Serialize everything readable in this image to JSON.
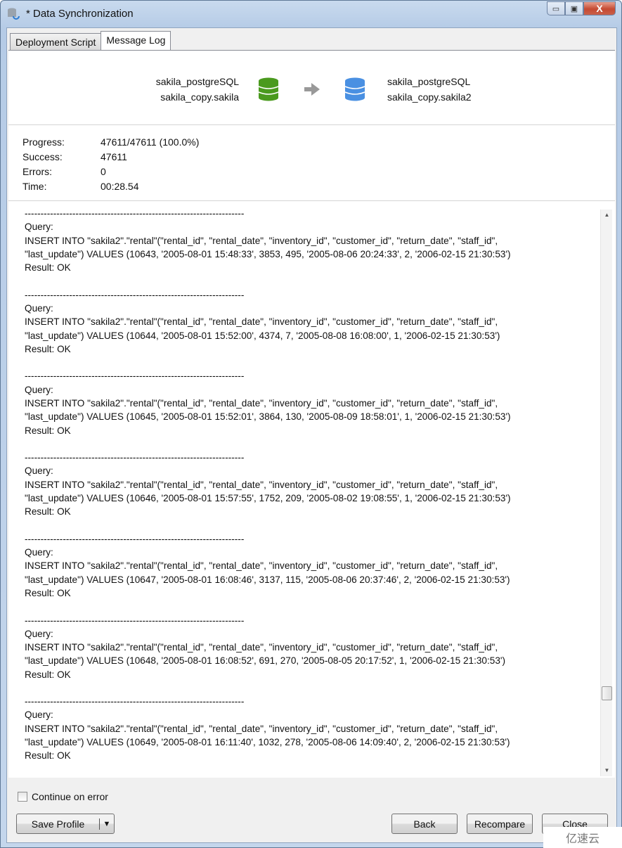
{
  "window": {
    "title": "* Data Synchronization",
    "buttons": {
      "minimize": "minimize",
      "maximize": "maximize",
      "close": "X"
    }
  },
  "tabs": [
    {
      "label": "Deployment Script",
      "active": false
    },
    {
      "label": "Message Log",
      "active": true
    }
  ],
  "header": {
    "source": {
      "connection": "sakila_postgreSQL",
      "schema": "sakila_copy.sakila",
      "icon_color": "#4a9a1e"
    },
    "target": {
      "connection": "sakila_postgreSQL",
      "schema": "sakila_copy.sakila2",
      "icon_color": "#4a90e2"
    }
  },
  "stats": [
    {
      "label": "Progress:",
      "value": "47611/47611 (100.0%)"
    },
    {
      "label": "Success:",
      "value": "47611"
    },
    {
      "label": "Errors:",
      "value": "0"
    },
    {
      "label": "Time:",
      "value": "00:28.54"
    }
  ],
  "progress_percent": 100,
  "log": {
    "separator": "---------------------------------------------------------------------",
    "entries": [
      {
        "label": "Query:",
        "line1": "INSERT INTO \"sakila2\".\"rental\"(\"rental_id\", \"rental_date\", \"inventory_id\", \"customer_id\", \"return_date\", \"staff_id\",",
        "line2": "\"last_update\") VALUES (10643, '2005-08-01 15:48:33', 3853, 495, '2005-08-06 20:24:33', 2, '2006-02-15 21:30:53')",
        "result": "Result: OK"
      },
      {
        "label": "Query:",
        "line1": "INSERT INTO \"sakila2\".\"rental\"(\"rental_id\", \"rental_date\", \"inventory_id\", \"customer_id\", \"return_date\", \"staff_id\",",
        "line2": "\"last_update\") VALUES (10644, '2005-08-01 15:52:00', 4374, 7, '2005-08-08 16:08:00', 1, '2006-02-15 21:30:53')",
        "result": "Result: OK"
      },
      {
        "label": "Query:",
        "line1": "INSERT INTO \"sakila2\".\"rental\"(\"rental_id\", \"rental_date\", \"inventory_id\", \"customer_id\", \"return_date\", \"staff_id\",",
        "line2": "\"last_update\") VALUES (10645, '2005-08-01 15:52:01', 3864, 130, '2005-08-09 18:58:01', 1, '2006-02-15 21:30:53')",
        "result": "Result: OK"
      },
      {
        "label": "Query:",
        "line1": "INSERT INTO \"sakila2\".\"rental\"(\"rental_id\", \"rental_date\", \"inventory_id\", \"customer_id\", \"return_date\", \"staff_id\",",
        "line2": "\"last_update\") VALUES (10646, '2005-08-01 15:57:55', 1752, 209, '2005-08-02 19:08:55', 1, '2006-02-15 21:30:53')",
        "result": "Result: OK"
      },
      {
        "label": "Query:",
        "line1": "INSERT INTO \"sakila2\".\"rental\"(\"rental_id\", \"rental_date\", \"inventory_id\", \"customer_id\", \"return_date\", \"staff_id\",",
        "line2": "\"last_update\") VALUES (10647, '2005-08-01 16:08:46', 3137, 115, '2005-08-06 20:37:46', 2, '2006-02-15 21:30:53')",
        "result": "Result: OK"
      },
      {
        "label": "Query:",
        "line1": "INSERT INTO \"sakila2\".\"rental\"(\"rental_id\", \"rental_date\", \"inventory_id\", \"customer_id\", \"return_date\", \"staff_id\",",
        "line2": "\"last_update\") VALUES (10648, '2005-08-01 16:08:52', 691, 270, '2005-08-05 20:17:52', 1, '2006-02-15 21:30:53')",
        "result": "Result: OK"
      },
      {
        "label": "Query:",
        "line1": "INSERT INTO \"sakila2\".\"rental\"(\"rental_id\", \"rental_date\", \"inventory_id\", \"customer_id\", \"return_date\", \"staff_id\",",
        "line2": "\"last_update\") VALUES (10649, '2005-08-01 16:11:40', 1032, 278, '2005-08-06 14:09:40', 2, '2006-02-15 21:30:53')",
        "result": "Result: OK"
      }
    ]
  },
  "footer": {
    "continue_on_error": {
      "label": "Continue on error",
      "checked": false
    },
    "save_profile": "Save Profile",
    "back": "Back",
    "recompare": "Recompare",
    "close": "Close"
  },
  "watermark": "亿速云"
}
